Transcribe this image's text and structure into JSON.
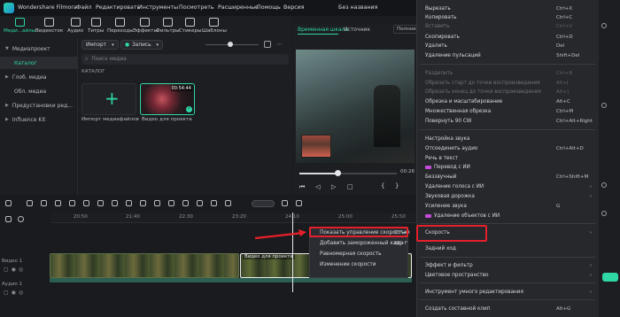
{
  "app": {
    "title": "Wondershare Filmora",
    "doc_title": "Без названия",
    "menu": [
      "Файл",
      "Редактировать",
      "Инструменты",
      "Посмотреть",
      "Расширенные",
      "Помощь",
      "Версия"
    ]
  },
  "toolbar": {
    "items": [
      "Меди...айлы",
      "Видеосток",
      "Аудио",
      "Титры",
      "Переходы",
      "Эффекты",
      "Фильтры",
      "Стикеры",
      "Шаблоны"
    ],
    "active": "Меди...айлы"
  },
  "sidebar": {
    "items": [
      "Медиапроект",
      "Каталог",
      "Глоб. медиа",
      "Обл. медиа",
      "Предустановки ред...",
      "Influence Kit"
    ],
    "selected": "Каталог"
  },
  "media": {
    "import_label": "Импорт",
    "record_label": "Запись",
    "search_placeholder": "Поиск медиа",
    "section_label": "КАТАЛОГ",
    "tiles": [
      {
        "label": "Импорт медиафайлов"
      },
      {
        "label": "Видео для проекта",
        "duration": "00:54:44"
      }
    ]
  },
  "preview": {
    "tab_timeline": "Временная шкала",
    "tab_source": "Источник",
    "quality": "Полное",
    "time": "00:26"
  },
  "timeline": {
    "ticks": [
      "20:50",
      "21:40",
      "22:30",
      "23:20",
      "24:10",
      "25:00",
      "25:50"
    ],
    "track_video": "Видео 1",
    "track_audio": "Аудио 1",
    "clip_label": "Видео для проекта"
  },
  "context_menu": {
    "items": [
      {
        "label": "Вырезать",
        "shortcut": "Ctrl+X",
        "enabled": true
      },
      {
        "label": "Копировать",
        "shortcut": "Ctrl+C",
        "enabled": true
      },
      {
        "label": "Вставить",
        "shortcut": "Ctrl+V",
        "enabled": false
      },
      {
        "label": "Скопировать",
        "shortcut": "Ctrl+D",
        "enabled": true
      },
      {
        "label": "Удалить",
        "shortcut": "Del",
        "enabled": true
      },
      {
        "label": "Удаление пульсаций",
        "shortcut": "Shift+Del",
        "enabled": true
      },
      {
        "label": "Разделить",
        "shortcut": "Ctrl+B",
        "enabled": false
      },
      {
        "label": "Обрезать старт до точки воспроизведения",
        "shortcut": "Alt+[",
        "enabled": false
      },
      {
        "label": "Обрезать конец до точки воспроизведения",
        "shortcut": "Alt+]",
        "enabled": false
      },
      {
        "label": "Обрезка и масштабирование",
        "shortcut": "Alt+C",
        "enabled": true
      },
      {
        "label": "Множественная обрезка",
        "shortcut": "Ctrl+M",
        "enabled": true
      },
      {
        "label": "Повернуть 90 CW",
        "shortcut": "Ctrl+Alt+Right",
        "enabled": true
      },
      {
        "label": "Настройка звука",
        "shortcut": "",
        "enabled": true
      },
      {
        "label": "Отсоединить аудио",
        "shortcut": "Ctrl+Alt+D",
        "enabled": true
      },
      {
        "label": "Речь в текст",
        "shortcut": "",
        "enabled": true
      },
      {
        "label": "Перевод с ИИ",
        "shortcut": "",
        "enabled": true
      },
      {
        "label": "Беззвучный",
        "shortcut": "Ctrl+Shift+M",
        "enabled": true
      },
      {
        "label": "Удаление голоса с ИИ",
        "shortcut": "",
        "enabled": true
      },
      {
        "label": "Звуковая дорожка",
        "shortcut": "",
        "enabled": true
      },
      {
        "label": "Усиление звука",
        "shortcut": "G",
        "enabled": true
      },
      {
        "label": "Удаление объектов с ИИ",
        "shortcut": "",
        "enabled": true
      },
      {
        "label": "Скорость",
        "shortcut": "",
        "enabled": true
      },
      {
        "label": "Задний ход",
        "shortcut": "",
        "enabled": true
      },
      {
        "label": "Эффект и фильтр",
        "shortcut": "",
        "enabled": true
      },
      {
        "label": "Цветовое пространство",
        "shortcut": "",
        "enabled": true
      },
      {
        "label": "Инструмент умного редактирования",
        "shortcut": "",
        "enabled": true
      },
      {
        "label": "Создать составной клип",
        "shortcut": "Alt+G",
        "enabled": true
      }
    ]
  },
  "speed_submenu": {
    "items": [
      {
        "label": "Показать управление скоростью",
        "shortcut": "Ctrl+R"
      },
      {
        "label": "Добавить замороженный кадр",
        "shortcut": "Alt+F"
      },
      {
        "label": "Равномерная скорость",
        "shortcut": ""
      },
      {
        "label": "Изменение скорости",
        "shortcut": ""
      }
    ]
  },
  "colors": {
    "accent": "#2fd7a6",
    "highlight": "#e5202a",
    "menu_bg": "#26282c"
  }
}
